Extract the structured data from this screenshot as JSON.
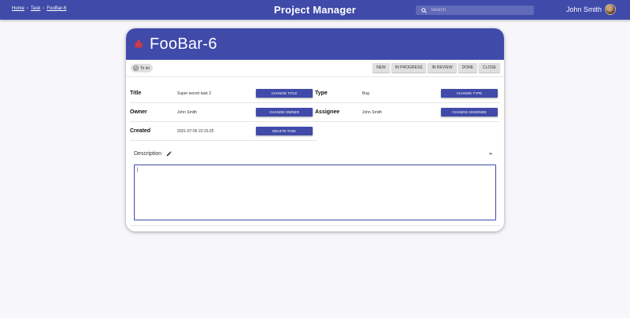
{
  "breadcrumb": {
    "items": [
      "Home",
      "Task",
      "FooBar-6"
    ],
    "separator": "›"
  },
  "app_title": "Project Manager",
  "search": {
    "placeholder": "Search",
    "value": ""
  },
  "user": {
    "name": "John Smith"
  },
  "task": {
    "key": "FooBar-6",
    "status_chip": "To do",
    "status_buttons": [
      "NEW",
      "IN PROGRESS",
      "IN REVIEW",
      "DONE",
      "CLOSE"
    ],
    "fields": {
      "title_label": "Title",
      "title_value": "Super secret task 2",
      "change_title": "CHANGE TITLE",
      "type_label": "Type",
      "type_value": "Bug",
      "change_type": "CHANGE TYPE",
      "owner_label": "Owner",
      "owner_value": "John Smith",
      "change_owner": "CHANGE OWNER",
      "assignee_label": "Assignee",
      "assignee_value": "John Smith",
      "change_assignee": "CHANGE ASSIGNEE",
      "created_label": "Created",
      "created_value": "2021-07-05 22:15:25",
      "delete_task": "DELETE TASK"
    },
    "description": {
      "label": "Description",
      "value": "|"
    }
  },
  "colors": {
    "primary": "#3f4aa9",
    "bug_icon": "#e53935",
    "background": "#f7f6fb"
  },
  "icons": [
    "search-icon",
    "bug-icon",
    "check-circle-icon",
    "pencil-icon",
    "chevron-up-icon"
  ]
}
